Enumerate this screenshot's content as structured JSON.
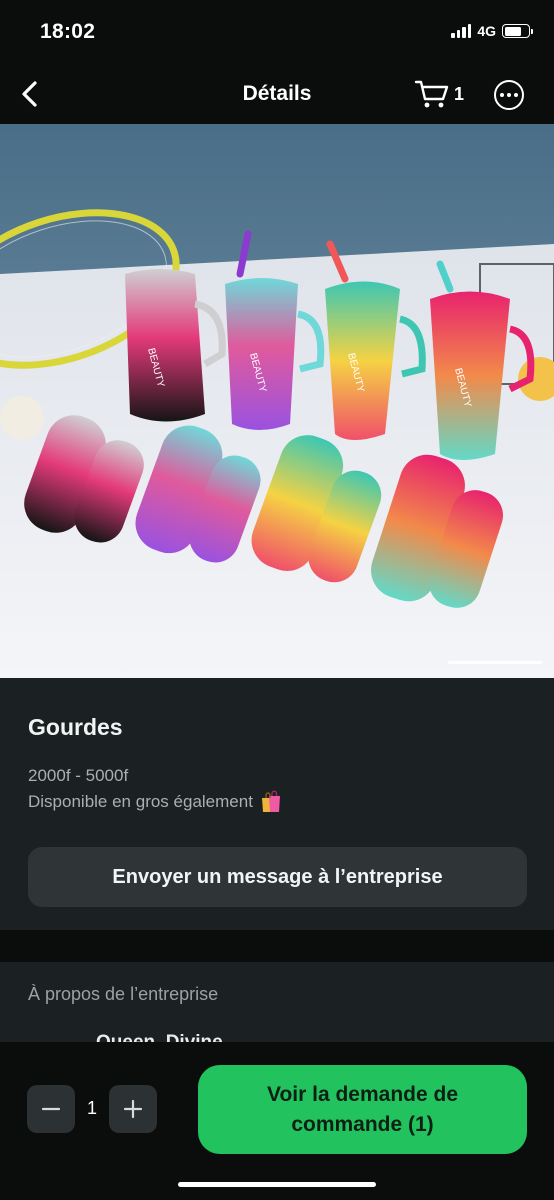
{
  "status_bar": {
    "time": "18:02",
    "network": "4G",
    "signal_bars": 4,
    "battery_level": 0.72
  },
  "nav": {
    "title": "Détails",
    "back_icon": "chevron-left-icon",
    "cart_icon": "shopping-cart-icon",
    "cart_count": "1",
    "more_icon": "more-horizontal-icon"
  },
  "product": {
    "image_alt": "Gourdes colorées BEAUTY",
    "bottle_brand_text": "BEAUTY",
    "title": "Gourdes",
    "price": "2000f - 5000f",
    "description": "Disponible en gros également",
    "description_emoji": "shopping-bags-icon"
  },
  "actions": {
    "message_button": "Envoyer un message à l’entreprise"
  },
  "about": {
    "title": "À propos de l’entreprise",
    "company_name": "Queen_Divine"
  },
  "bottom_bar": {
    "quantity": "1",
    "order_button": "Voir la demande de commande (1)"
  },
  "colors": {
    "background": "#0b0d0d",
    "card": "#1b2022",
    "secondary_button": "#2f3537",
    "accent_green": "#22c35e"
  }
}
